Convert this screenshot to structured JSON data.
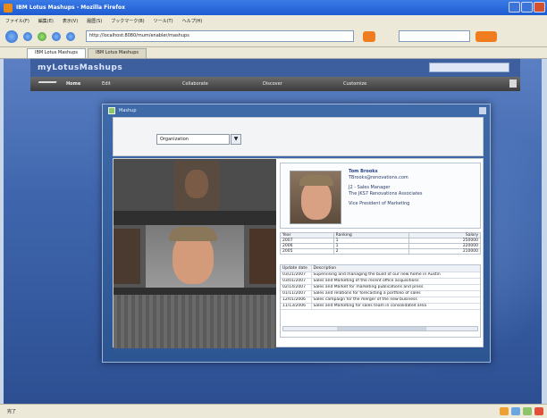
{
  "browser": {
    "title": "IBM Lotus Mashups - Mozilla Firefox",
    "menu": [
      "ファイル(F)",
      "編集(E)",
      "表示(V)",
      "履歴(S)",
      "ブックマーク(B)",
      "ツール(T)",
      "ヘルプ(H)"
    ],
    "url": "http://localhost:8080/mum/enabler/mashups",
    "tabs": [
      "IBM Lotus Mashups",
      "IBM Lotus Mashups"
    ],
    "status": "完了"
  },
  "app": {
    "brand": "myLotusMashups",
    "nav": [
      "Home",
      "Edit",
      "Collaborate",
      "Discover",
      "Customize"
    ]
  },
  "widget": {
    "title": "Mashup",
    "select_value": "Organization",
    "select_arrow": "▼"
  },
  "person": {
    "name": "Tom Brooks",
    "email": "TBrooks@renovations.com",
    "title": "J2 - Sales Manager",
    "org": "The JKS7 Renovations Associates",
    "location": "Vice President of Marketing"
  },
  "table1": {
    "headers": [
      "Year",
      "Ranking",
      "Salary"
    ],
    "rows": [
      [
        "2007",
        "1",
        "250000"
      ],
      [
        "2006",
        "1",
        "220000"
      ],
      [
        "2005",
        "2",
        "210000"
      ]
    ]
  },
  "table2": {
    "headers": [
      "Update date",
      "Description"
    ],
    "rows": [
      [
        "03/21/2007",
        "Supervising and managing the build of our new home in Austin"
      ],
      [
        "03/01/2007",
        "Sales and Marketing of the recent office acquisitions"
      ],
      [
        "02/14/2007",
        "Sales and Market for marketing publications and press"
      ],
      [
        "01/11/2007",
        "Sales and relations for forecasting a portfolio of sales"
      ],
      [
        "12/01/2006",
        "Sales campaign for the merger of the new business"
      ],
      [
        "11/13/2006",
        "Sales and Marketing for sales team in consolidated area"
      ]
    ]
  },
  "colors": {
    "viewport_bg": "#3f66ad",
    "app_header": "#3d5f9e",
    "nav_bar": "#4a4a4a",
    "name_link": "#25408d"
  }
}
